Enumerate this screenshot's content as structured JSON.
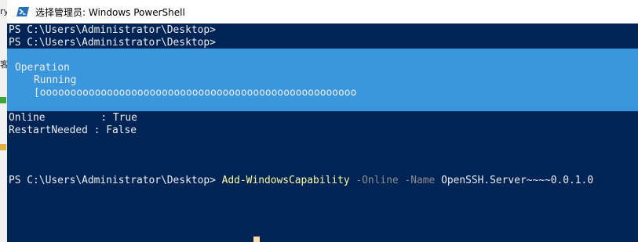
{
  "window": {
    "title": "选择管理员: Windows PowerShell"
  },
  "behind": {
    "glyph_1": "ry",
    "glyph_2": "客"
  },
  "console": {
    "prompt_1": "PS C:\\Users\\Administrator\\Desktop>",
    "prompt_2": "PS C:\\Users\\Administrator\\Desktop>",
    "progress": {
      "activity": "Operation",
      "status": "Running",
      "bar": "[oooooooooooooooooooooooooooooooooooooooooooooooooooo"
    },
    "result": [
      {
        "key": "Online",
        "sep": " : ",
        "value": "True"
      },
      {
        "key": "RestartNeeded",
        "sep": " : ",
        "value": "False"
      }
    ],
    "command_line": {
      "prompt": "PS C:\\Users\\Administrator\\Desktop> ",
      "cmdlet": "Add-WindowsCapability",
      "param_online": "-Online",
      "param_name": "-Name",
      "argument": "OpenSSH.Server~~~~0.0.1.0"
    }
  },
  "colors": {
    "console_bg": "#012456",
    "progress_bg": "#3a96dd",
    "text": "#eeedf0",
    "cmdlet": "#fcfc9e",
    "parameter": "#8c8c8c",
    "cursor": "#fcd9a6"
  }
}
